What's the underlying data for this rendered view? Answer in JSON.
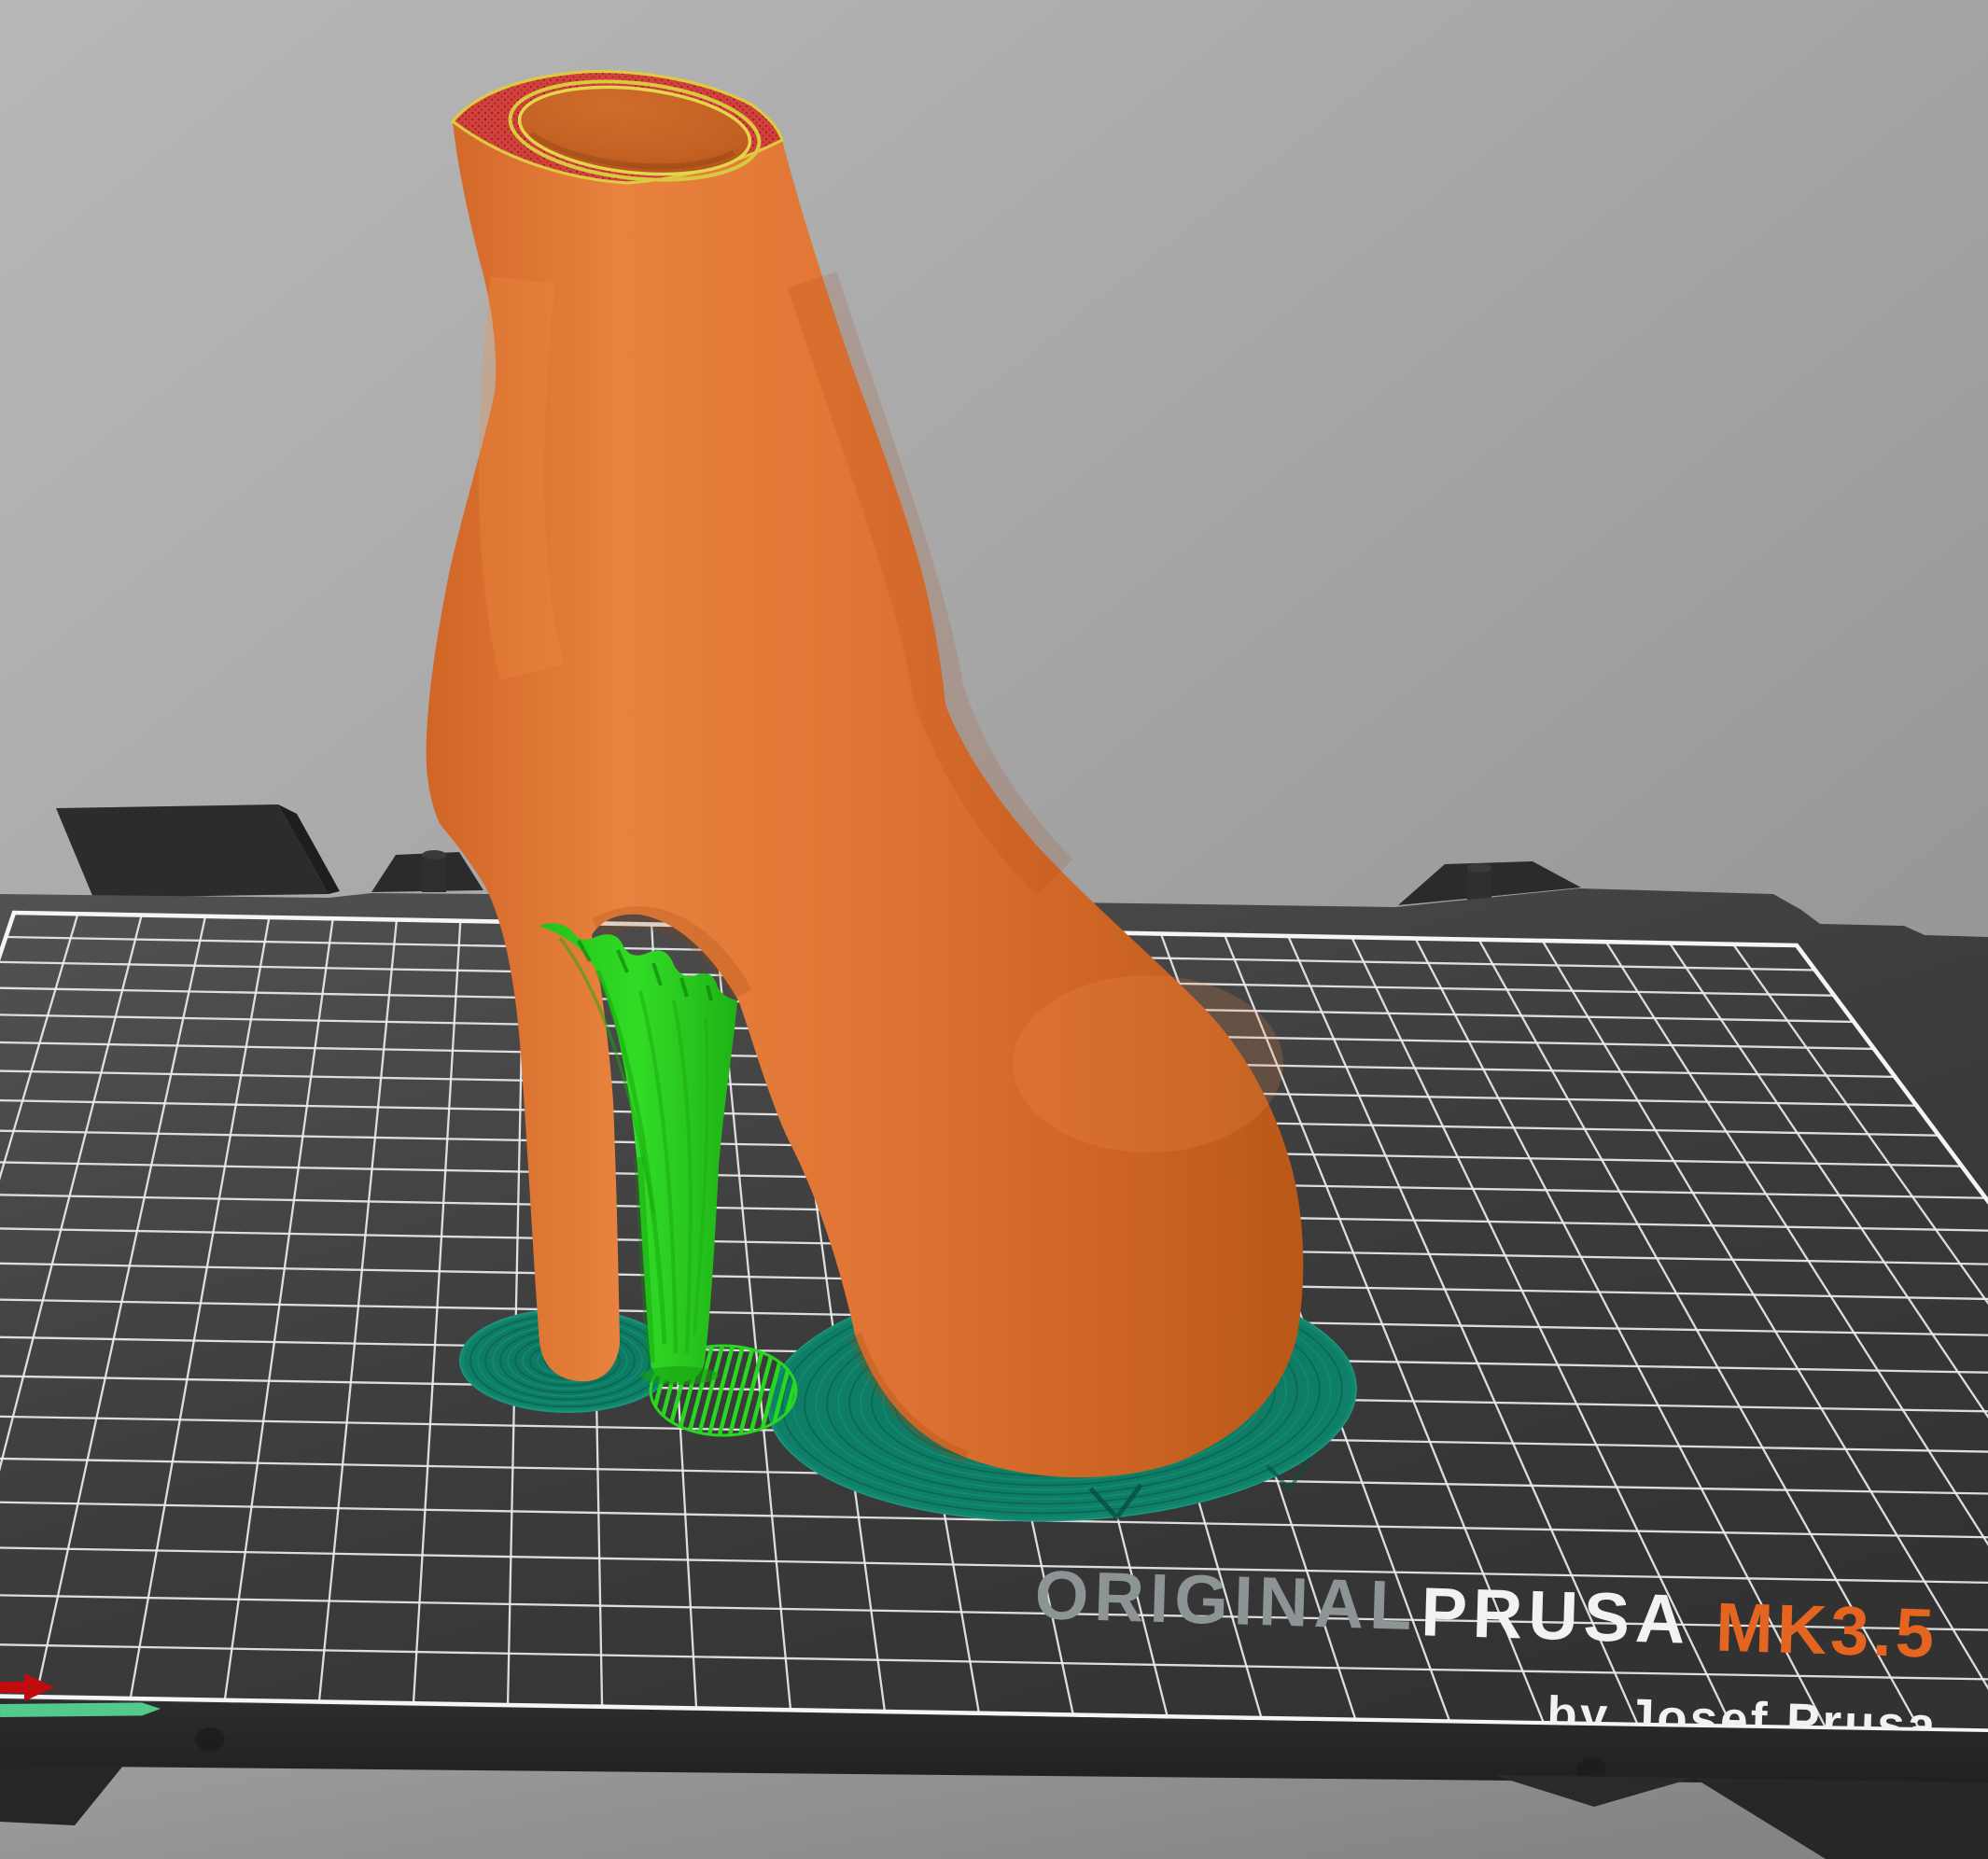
{
  "viewport": {
    "description": "PrusaSlicer 3D viewport - sliced G-code preview of a high heel bootie on the print bed"
  },
  "plate": {
    "brand_prefix": "ORIGINAL",
    "brand": "PRUSA",
    "model": "MK3.5",
    "byline": "by Josef Prusa"
  },
  "scene_objects": {
    "model": "high-heel-bootie",
    "supports": "organic-tree-supports",
    "brim_pads": "brim-raft-pads",
    "top_layer": "top-infill-ring"
  },
  "colors": {
    "model_orange": "#e07434",
    "model_orange_dark": "#c25e1f",
    "model_orange_light": "#ec8742",
    "support_green": "#2bd320",
    "support_green_dark": "#18a90e",
    "brim_teal": "#0e7b65",
    "brim_teal_line": "#0a6753",
    "top_infill_red": "#d4403c",
    "perimeter_yellow": "#dcca40",
    "bed_surface": "#454545",
    "bed_frame": "#2a2a2a",
    "grid_white": "#ececec",
    "text_gray": "#8d9495",
    "text_white": "#f2f2f2",
    "text_orange": "#e56520",
    "axis_x_red": "#c00c0c",
    "axis_y_green": "#55c98b",
    "background_gray": "#a6a6a6"
  }
}
